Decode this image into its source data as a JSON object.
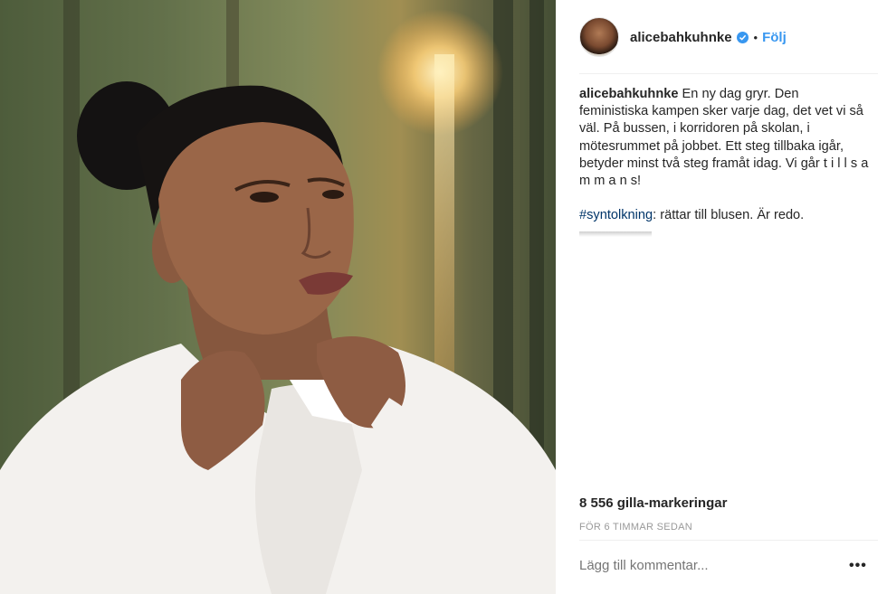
{
  "post": {
    "username": "alicebahkuhnke",
    "follow_label": "Följ",
    "dot": "•",
    "caption_user": "alicebahkuhnke",
    "caption_text": " En ny dag gryr. Den feministiska kampen sker varje dag, det vet vi så väl. På bussen, i korridoren på skolan, i mötesrummet på jobbet. Ett steg tillbaka igår, betyder minst två steg framåt idag. Vi går t i l l s a m m a n s!",
    "hashtag": "#syntolkning",
    "hashtag_text": ": rättar till blusen. Är redo.",
    "likes": "8 556 gilla-markeringar",
    "timestamp": "FÖR 6 TIMMAR SEDAN",
    "comment_placeholder": "Lägg till kommentar...",
    "more_label": "•••"
  },
  "icons": {
    "verified": "verified-badge-icon",
    "more": "more-options-icon"
  },
  "colors": {
    "accent": "#3897f0",
    "hashtag": "#003569",
    "muted": "#999999"
  }
}
